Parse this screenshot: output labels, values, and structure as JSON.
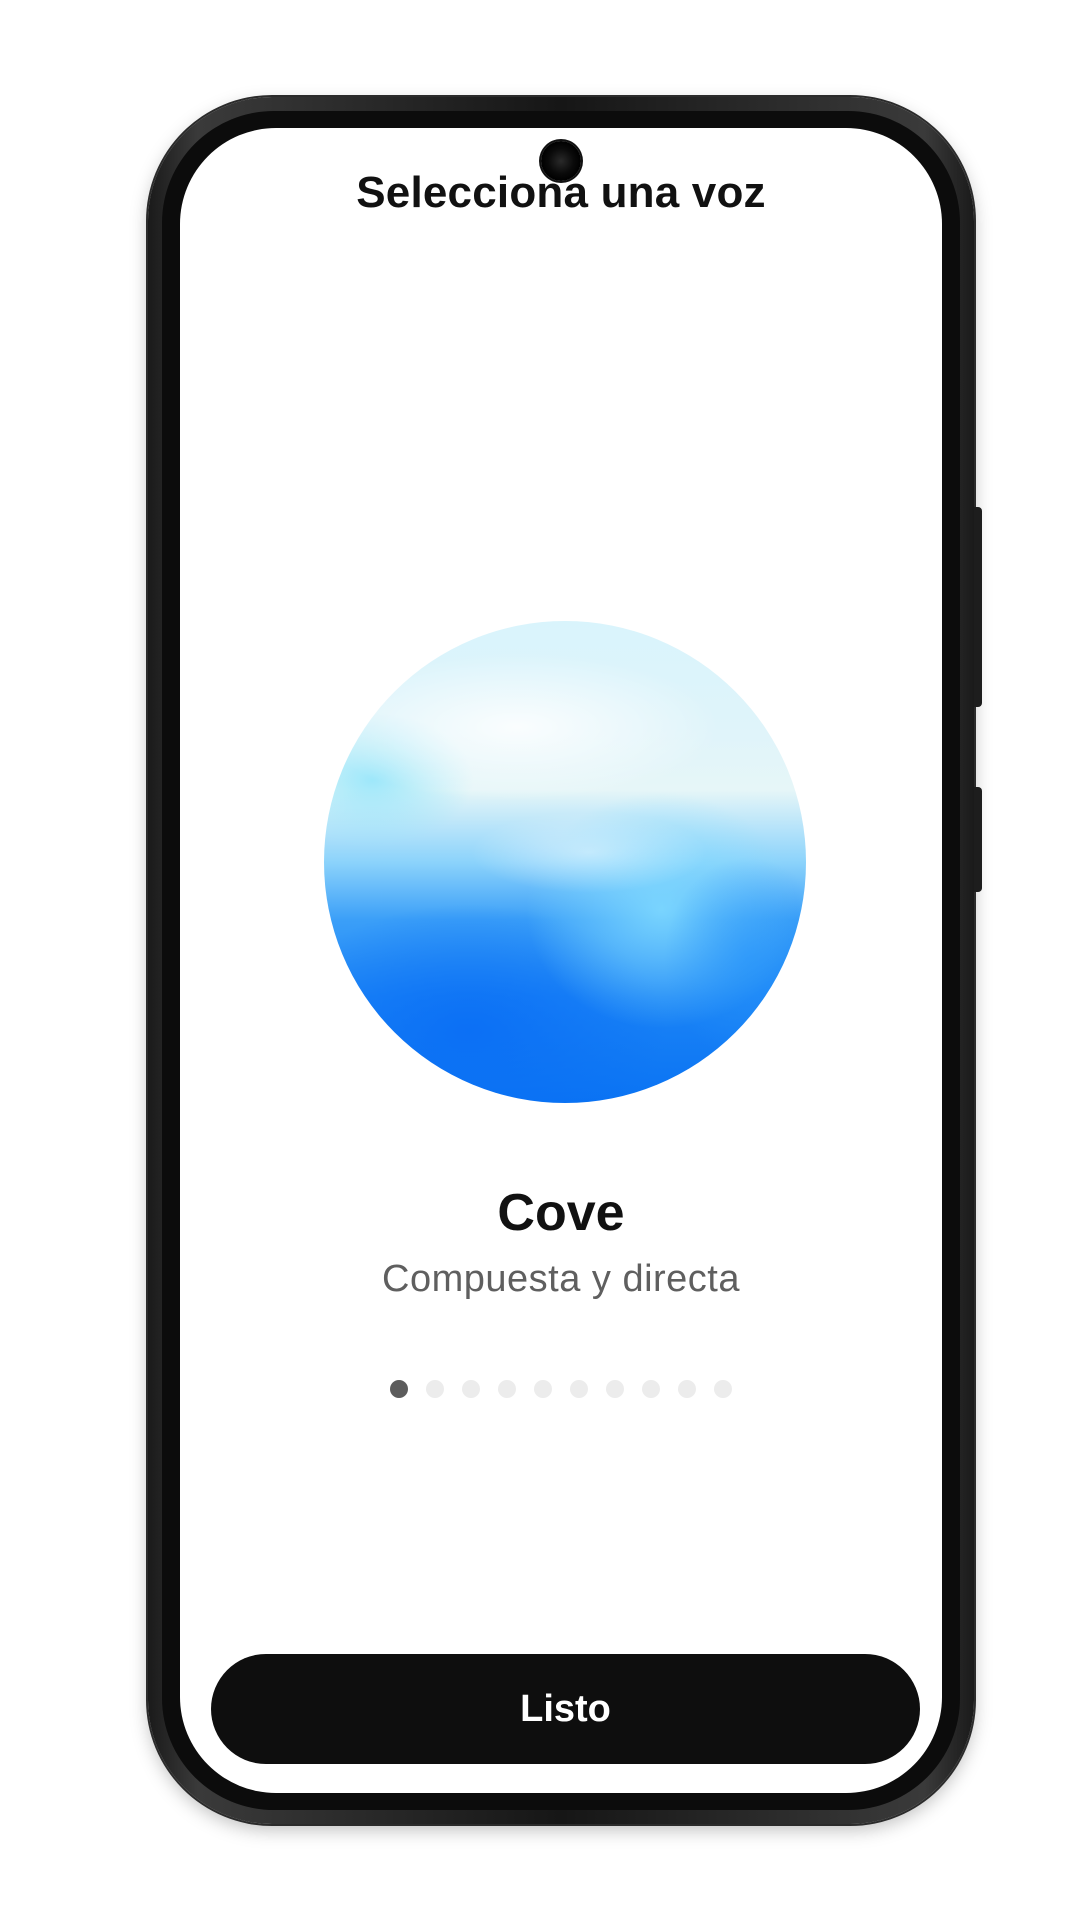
{
  "screen": {
    "title": "Selecciona una voz"
  },
  "voice": {
    "name": "Cove",
    "description": "Compuesta y directa",
    "orb_colors": [
      "#d9f4fc",
      "#8cd3fb",
      "#1b84f6",
      "#0a73f3"
    ]
  },
  "pagination": {
    "total": 10,
    "current": 1
  },
  "actions": {
    "done_label": "Listo"
  },
  "colors": {
    "button_bg": "#0e0e0e",
    "title_text": "#111111",
    "subtitle_text": "#5f5f5f",
    "dot_active": "#5c5c5c",
    "dot_inactive": "#ececec"
  }
}
